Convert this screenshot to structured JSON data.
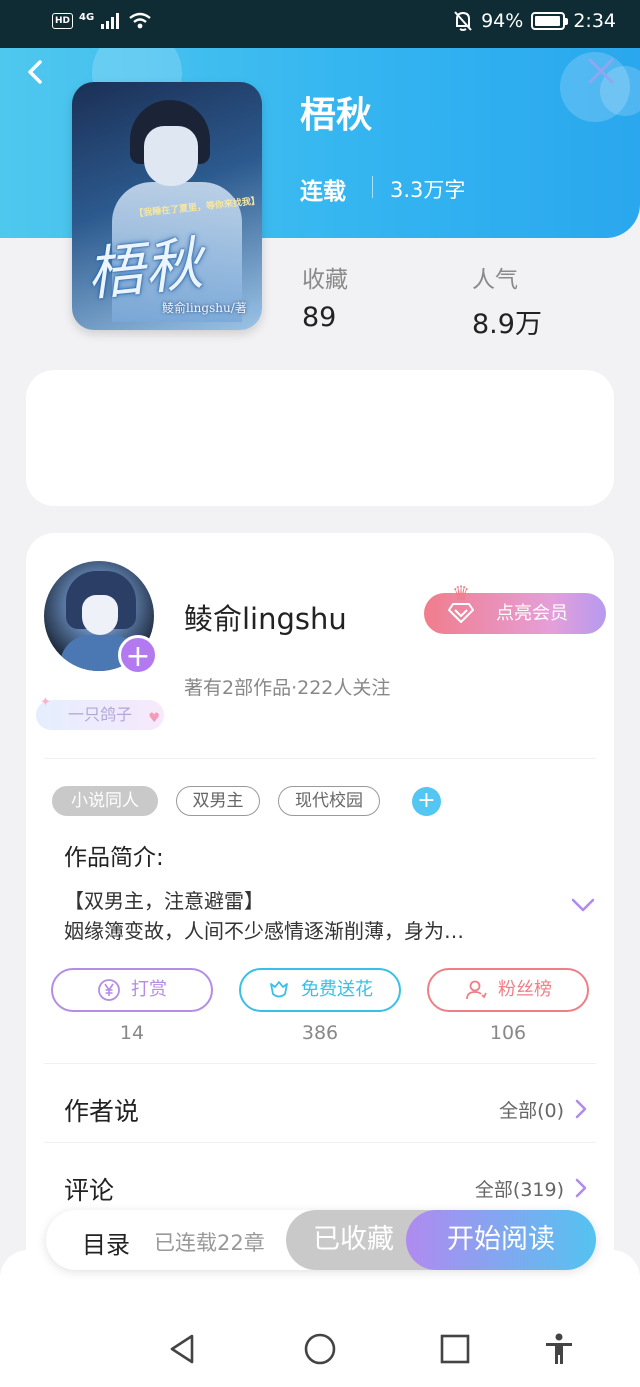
{
  "status_bar": {
    "hd": "HD",
    "network": "4G",
    "battery_percent": "94%",
    "battery_level": 0.94,
    "time": "2:34",
    "icons": [
      "signal-icon",
      "wifi-icon",
      "bell-muted-icon",
      "battery-icon"
    ]
  },
  "header": {
    "back_icon": "chevron-left-icon",
    "close_icon": "close-icon"
  },
  "book": {
    "cover": {
      "tagline": "【我睡在了夏里，等你来找我】",
      "title_art": "梧秋",
      "pen_name": "鲮俞lingshu/著"
    },
    "title": "梧秋",
    "status": "连载",
    "word_count": "3.3万字",
    "stats": [
      {
        "label": "收藏",
        "value": "89"
      },
      {
        "label": "人气",
        "value": "8.9万"
      }
    ]
  },
  "author": {
    "name": "鲮俞lingshu",
    "meta": "著有2部作品·222人关注",
    "badge": "一只鸽子",
    "vip_button": "点亮会员",
    "follow_icon": "plus-icon"
  },
  "tags": [
    {
      "label": "小说同人",
      "filled": true
    },
    {
      "label": "双男主",
      "filled": false
    },
    {
      "label": "现代校园",
      "filled": false
    }
  ],
  "intro": {
    "label": "作品简介:",
    "line1": "【双男主，注意避雷】",
    "line2": "姻缘簿变故，人间不少感情逐渐削薄，身为…"
  },
  "actions": [
    {
      "label": "打赏",
      "count": "14",
      "icon": "yen-coin-icon",
      "color": "#b38de6"
    },
    {
      "label": "免费送花",
      "count": "386",
      "icon": "flower-icon",
      "color": "#37c1e8"
    },
    {
      "label": "粉丝榜",
      "count": "106",
      "icon": "fans-icon",
      "color": "#ef7f86"
    }
  ],
  "sections": [
    {
      "title": "作者说",
      "link": "全部(0)"
    },
    {
      "title": "评论",
      "link": "全部(319)"
    }
  ],
  "bottom_bar": {
    "toc": "目录",
    "serial_status": "已连载22章",
    "favorited": "已收藏",
    "start_reading": "开始阅读"
  },
  "colors": {
    "header_blue": "#33b4f0",
    "accent_purple": "#b08af0",
    "accent_cyan": "#54c3f0",
    "vip_pink": "#f07d8c"
  }
}
